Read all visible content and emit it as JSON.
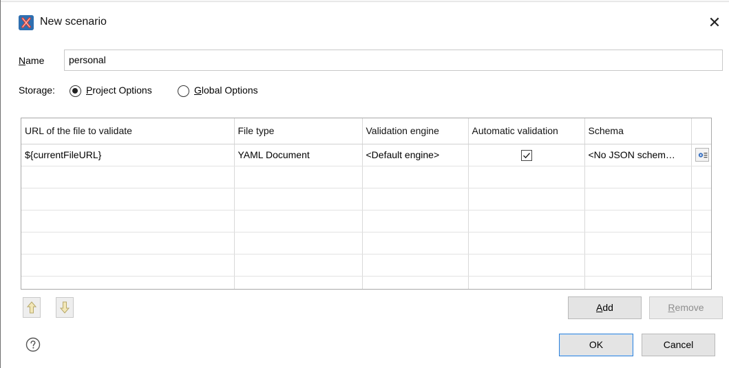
{
  "window": {
    "title": "New scenario",
    "close_glyph": "✕"
  },
  "name": {
    "label_mnemonic": "N",
    "label_rest": "ame",
    "value": "personal"
  },
  "storage": {
    "label": "Storage:",
    "options": [
      {
        "mnemonic": "P",
        "rest": "roject Options",
        "checked": true
      },
      {
        "mnemonic": "G",
        "rest": "lobal Options",
        "checked": false
      }
    ]
  },
  "table": {
    "columns": [
      "URL of the file to validate",
      "File type",
      "Validation engine",
      "Automatic validation",
      "Schema",
      ""
    ],
    "rows": [
      {
        "url": "${currentFileURL}",
        "file_type": "YAML Document",
        "engine": "<Default engine>",
        "automatic": true,
        "schema": "<No JSON schem…"
      }
    ]
  },
  "buttons": {
    "move_up": {
      "icon": "arrow-up-icon"
    },
    "move_down": {
      "icon": "arrow-down-icon"
    },
    "add": {
      "mnemonic": "A",
      "rest": "dd"
    },
    "remove": {
      "mnemonic": "R",
      "rest": "emove"
    },
    "ok": "OK",
    "cancel": "Cancel"
  },
  "icons": {
    "app": "oxygen-x-icon",
    "help": "help-icon",
    "schema": "schema-settings-icon"
  },
  "colors": {
    "accent": "#2f7fd4",
    "app_icon": "#2f6fb0",
    "app_icon_mark": "#e23b2e"
  }
}
